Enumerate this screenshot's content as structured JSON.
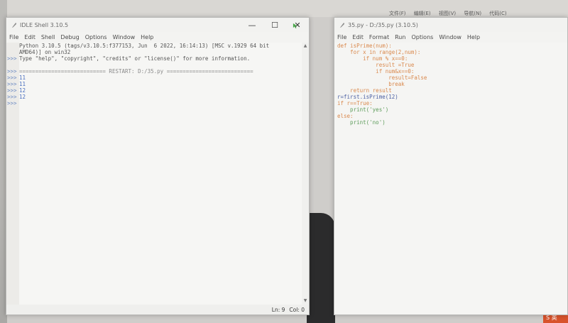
{
  "background": {
    "menu_items": [
      "文件(F)",
      "编辑(E)",
      "视图(V)",
      "导航(N)",
      "代码(C)"
    ],
    "brand_text": "S 英"
  },
  "shell": {
    "title": "IDLE Shell 3.10.5",
    "controls": [
      "—",
      "☐",
      "✕"
    ],
    "menu": [
      "File",
      "Edit",
      "Shell",
      "Debug",
      "Options",
      "Window",
      "Help"
    ],
    "lines": [
      "Python 3.10.5 (tags/v3.10.5:f377153, Jun  6 2022, 16:14:13) [MSC v.1929 64 bit",
      "AMD64)] on win32",
      "Type \"help\", \"copyright\", \"credits\" or \"license()\" for more information.",
      "",
      "=========================== RESTART: D:/35.py ===========================",
      "11",
      "11",
      "12",
      "12",
      ""
    ],
    "prompts": [
      "",
      "",
      ">>>",
      "",
      ">>>",
      ">>>",
      ">>>",
      ">>>",
      ">>>",
      ">>>"
    ],
    "status": {
      "line": "Ln: 9",
      "col": "Col: 0"
    },
    "colors": {
      "output": "#4a6fbf",
      "prompt": "#6b8ac2"
    }
  },
  "editor": {
    "title": "35.py - D:/35.py (3.10.5)",
    "menu": [
      "File",
      "Edit",
      "Format",
      "Run",
      "Options",
      "Window",
      "Help"
    ],
    "code": [
      "def isPrime(num):",
      "    for x in range(2,num):",
      "        if num % x==0:",
      "            result =True",
      "            if num&x==0:",
      "                result=False",
      "                break",
      "    return result",
      "r=first.isPrime(12)",
      "if r==True:",
      "    print('yes')",
      "else:",
      "    print('no')"
    ],
    "colors": {
      "keyword": "#d9884c",
      "string": "#5d9c5a",
      "name": "#4a5fa3"
    }
  }
}
